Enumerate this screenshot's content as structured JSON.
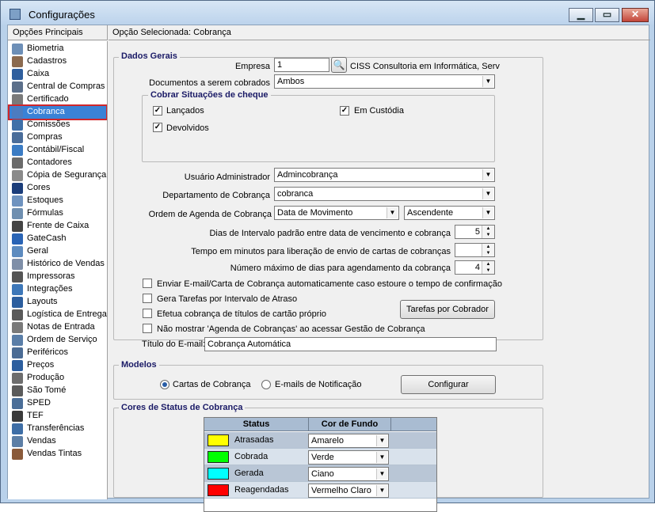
{
  "window": {
    "title": "Configurações"
  },
  "sidebar": {
    "header": "Opções Principais",
    "items": [
      {
        "label": "Biometria",
        "icon": "fingerprint-icon",
        "color": "#6d8fb7"
      },
      {
        "label": "Cadastros",
        "icon": "people-icon",
        "color": "#8b6a4f"
      },
      {
        "label": "Caixa",
        "icon": "dollar-icon",
        "color": "#2f5f9e"
      },
      {
        "label": "Central de Compras",
        "icon": "cart-icon",
        "color": "#5b6f8a"
      },
      {
        "label": "Certificado",
        "icon": "certificate-icon",
        "color": "#7a7a7a"
      },
      {
        "label": "Cobranca",
        "icon": "wrench-icon",
        "color": "#4c7cc0",
        "selected": true
      },
      {
        "label": "Comissões",
        "icon": "coin-icon",
        "color": "#3f6fa8"
      },
      {
        "label": "Compras",
        "icon": "basket-icon",
        "color": "#4a6d9a"
      },
      {
        "label": "Contábil/Fiscal",
        "icon": "funnel-icon",
        "color": "#3b7cc4"
      },
      {
        "label": "Contadores",
        "icon": "percent-icon",
        "color": "#6b6b6b"
      },
      {
        "label": "Cópia de Segurança",
        "icon": "document-icon",
        "color": "#8a8a8a"
      },
      {
        "label": "Cores",
        "icon": "palette-icon",
        "color": "#1b3d7a"
      },
      {
        "label": "Estoques",
        "icon": "box-icon",
        "color": "#6f93bf"
      },
      {
        "label": "Fórmulas",
        "icon": "sqrt-icon",
        "color": "#6f8fb0"
      },
      {
        "label": "Frente de Caixa",
        "icon": "barcode-icon",
        "color": "#444444"
      },
      {
        "label": "GateCash",
        "icon": "gatecash-icon",
        "color": "#2a64b5"
      },
      {
        "label": "Geral",
        "icon": "globe-icon",
        "color": "#5d8bbf"
      },
      {
        "label": "Histórico de Vendas",
        "icon": "history-icon",
        "color": "#7f8fa8"
      },
      {
        "label": "Impressoras",
        "icon": "printer-icon",
        "color": "#555555"
      },
      {
        "label": "Integrações",
        "icon": "integration-icon",
        "color": "#3d77b8"
      },
      {
        "label": "Layouts",
        "icon": "layout-icon",
        "color": "#2c5e9e"
      },
      {
        "label": "Logística de Entrega",
        "icon": "truck-icon",
        "color": "#5a5a5a"
      },
      {
        "label": "Notas de Entrada",
        "icon": "notes-icon",
        "color": "#7a7a7a"
      },
      {
        "label": "Ordem de Serviço",
        "icon": "service-order-icon",
        "color": "#5a7ea8"
      },
      {
        "label": "Periféricos",
        "icon": "peripheral-icon",
        "color": "#4b6c95"
      },
      {
        "label": "Preços",
        "icon": "price-icon",
        "color": "#2c5e9e"
      },
      {
        "label": "Produção",
        "icon": "production-icon",
        "color": "#6d6d6d"
      },
      {
        "label": "São Tomé",
        "icon": "sao-tome-icon",
        "color": "#5b5b5b"
      },
      {
        "label": "SPED",
        "icon": "sped-icon",
        "color": "#4a6e98"
      },
      {
        "label": "TEF",
        "icon": "tef-icon",
        "color": "#3a3a3a"
      },
      {
        "label": "Transferências",
        "icon": "transfer-icon",
        "color": "#3e6ea6"
      },
      {
        "label": "Vendas",
        "icon": "sales-icon",
        "color": "#5d7fa6"
      },
      {
        "label": "Vendas Tintas",
        "icon": "paint-icon",
        "color": "#8a5a3a"
      }
    ]
  },
  "main": {
    "selected_label": "Opção Selecionada: Cobrança",
    "dados_gerais": {
      "title": "Dados Gerais",
      "empresa_label": "Empresa",
      "empresa_value": "1",
      "empresa_name": "CISS Consultoria em Informática, Serv",
      "documentos_label": "Documentos a serem cobrados",
      "documentos_value": "Ambos",
      "cheque_group_title": "Cobrar Situações de cheque",
      "lancados_label": "Lançados",
      "em_custodia_label": "Em Custódia",
      "devolvidos_label": "Devolvidos",
      "usuario_label": "Usuário Administrador",
      "usuario_value": "Admincobrança",
      "departamento_label": "Departamento de Cobrança",
      "departamento_value": "cobranca",
      "ordem_label": "Ordem de Agenda de Cobrança",
      "ordem_value": "Data de Movimento",
      "ordem_dir_value": "Ascendente",
      "dias_intervalo_label": "Dias de Intervalo padrão entre data de vencimento e cobrança",
      "dias_intervalo_value": "5",
      "tempo_minutos_label": "Tempo em minutos para liberação de envio de cartas de cobranças",
      "tempo_minutos_value": "",
      "max_dias_label": "Número máximo de dias para agendamento da cobrança",
      "max_dias_value": "4",
      "enviar_email_label": "Enviar E-mail/Carta de Cobrança automaticamente caso estoure o tempo de confirmação",
      "gera_tarefas_label": "Gera Tarefas por Intervalo de Atraso",
      "efetua_cobranca_label": "Efetua cobrança de títulos de cartão próprio",
      "nao_mostrar_label": "Não mostrar 'Agenda de Cobranças' ao acessar Gestão de Cobrança",
      "tarefas_button": "Tarefas por Cobrador",
      "titulo_email_label": "Título do E-mail:",
      "titulo_email_value": "Cobrança Automática"
    },
    "modelos": {
      "title": "Modelos",
      "cartas_label": "Cartas de Cobrança",
      "emails_label": "E-mails de Notificação",
      "configurar_button": "Configurar"
    },
    "cores_status": {
      "title": "Cores de Status de Cobrança",
      "columns": [
        "Status",
        "Cor de Fundo"
      ],
      "rows": [
        {
          "status": "Atrasadas",
          "cor": "Amarelo",
          "swatch": "#ffff00"
        },
        {
          "status": "Cobrada",
          "cor": "Verde",
          "swatch": "#00ff00"
        },
        {
          "status": "Gerada",
          "cor": "Ciano",
          "swatch": "#00ffff"
        },
        {
          "status": "Reagendadas",
          "cor": "Vermelho Claro",
          "swatch": "#ff0000"
        }
      ]
    }
  }
}
